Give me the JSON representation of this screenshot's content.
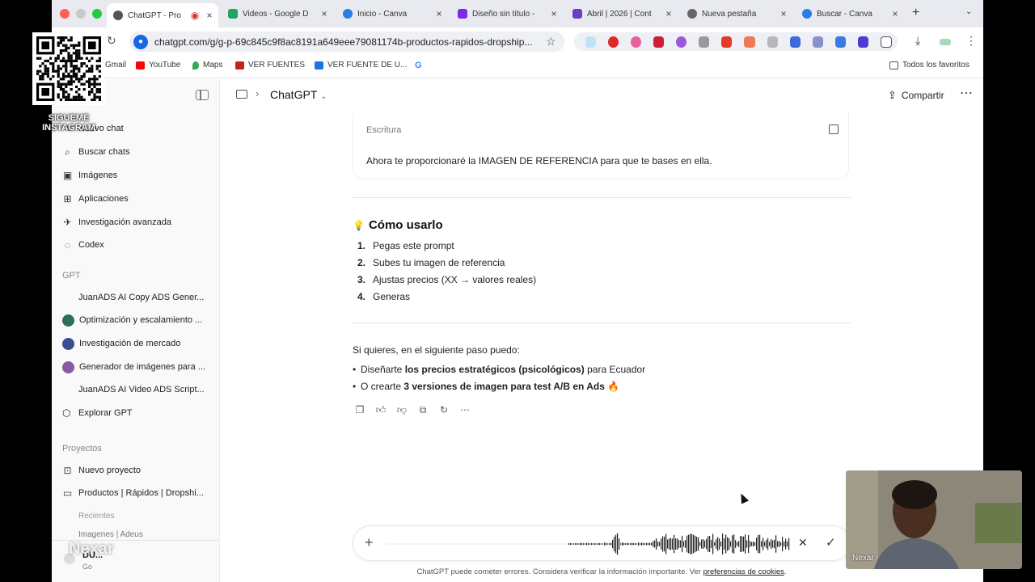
{
  "browser": {
    "tabs": [
      {
        "label": "ChatGPT - Pro",
        "favicon_color": "#555555",
        "active": true
      },
      {
        "label": "Videos - Google D",
        "favicon_color": "#1fa463",
        "active": false
      },
      {
        "label": "Inicio - Canva",
        "favicon_color": "#2a7de1",
        "active": false
      },
      {
        "label": "Diseño sin título -",
        "favicon_color": "#7d2ae8",
        "active": false
      },
      {
        "label": "Abril | 2026 | Cont",
        "favicon_color": "#6a3cc8",
        "active": false
      },
      {
        "label": "Nueva pestaña",
        "favicon_color": "#666666",
        "active": false
      },
      {
        "label": "Buscar - Canva",
        "favicon_color": "#2a7de1",
        "active": false
      }
    ],
    "url": "chatgpt.com/g/g-p-69c845c9f8ac8191a649eee79081174b-productos-rapidos-dropship...",
    "bookmarks": [
      {
        "label": "Gmail",
        "color": "#d93025"
      },
      {
        "label": "YouTube",
        "color": "#ff0000"
      },
      {
        "label": "Maps",
        "color": "#34a853"
      },
      {
        "label": "VER FUENTES",
        "color": "#c5221f"
      },
      {
        "label": "VER FUENTE DE U...",
        "color": "#1a73e8"
      },
      {
        "label": "",
        "color": "#4285f4"
      }
    ],
    "all_bookmarks": "Todos los favoritos"
  },
  "sidebar": {
    "nav": [
      {
        "label": "Nuevo chat",
        "icon": "new-chat-icon"
      },
      {
        "label": "Buscar chats",
        "icon": "search-icon"
      },
      {
        "label": "Imágenes",
        "icon": "images-icon"
      },
      {
        "label": "Aplicaciones",
        "icon": "apps-icon"
      },
      {
        "label": "Investigación avanzada",
        "icon": "deep-research-icon"
      },
      {
        "label": "Codex",
        "icon": "codex-icon"
      }
    ],
    "gpt_section": "GPT",
    "gpts": [
      {
        "label": "JuanADS AI Copy ADS Gener...",
        "avatar": ""
      },
      {
        "label": "Optimización y escalamiento ...",
        "avatar": "#2f6f5a"
      },
      {
        "label": "Investigación de mercado",
        "avatar": "#3b4d8f"
      },
      {
        "label": "Generador de imágenes para ...",
        "avatar": "#8a5a9c"
      },
      {
        "label": "JuanADS AI Video ADS Script...",
        "avatar": ""
      },
      {
        "label": "Explorar GPT",
        "avatar": "grid"
      }
    ],
    "projects_section": "Proyectos",
    "projects": [
      {
        "label": "Nuevo proyecto",
        "icon": "new-folder-icon"
      },
      {
        "label": "Productos | Rápidos | Dropshi...",
        "icon": "folder-icon"
      }
    ],
    "project_sub_label": "Recientes",
    "project_sub_item": "Imagenes | Adeus",
    "user_name": "DU...",
    "user_plan": "Go"
  },
  "header": {
    "model": "ChatGPT",
    "share": "Compartir"
  },
  "conversation": {
    "card_label": "Escritura",
    "card_text": "Ahora te proporcionaré la IMAGEN DE REFERENCIA para que te bases en ella.",
    "heading_emoji": "💡",
    "heading": "Cómo usarlo",
    "steps": [
      {
        "n": "1.",
        "text": "Pegas este prompt"
      },
      {
        "n": "2.",
        "text": "Subes tu imagen de referencia"
      },
      {
        "n": "3.",
        "text": "Ajustas precios (XX → valores reales)"
      },
      {
        "n": "4.",
        "text": "Generas"
      }
    ],
    "followup_intro": "Si quieres, en el siguiente paso puedo:",
    "bullet1_pre": "Diseñarte ",
    "bullet1_bold": "los precios estratégicos (psicológicos)",
    "bullet1_post": " para Ecuador",
    "bullet2_pre": "O crearte ",
    "bullet2_bold": "3 versiones de imagen para test A/B en Ads",
    "bullet2_post": " 🔥"
  },
  "composer": {
    "disclaimer": "ChatGPT puede cometer errores. Considera verificar la información importante. Ver ",
    "disclaimer_link": "preferencias de cookies",
    "disclaimer_end": "."
  },
  "overlays": {
    "qr_caption_line1": "SIGUEME",
    "qr_caption_line2": "INSTAGRAM",
    "brand_watermark": "Nexar",
    "webcam_label": "Nexar"
  },
  "colors": {
    "accent_blue": "#1a66e8",
    "traffic_red": "#ff5f57",
    "traffic_yellow": "#febc2e",
    "traffic_green": "#28c840"
  }
}
